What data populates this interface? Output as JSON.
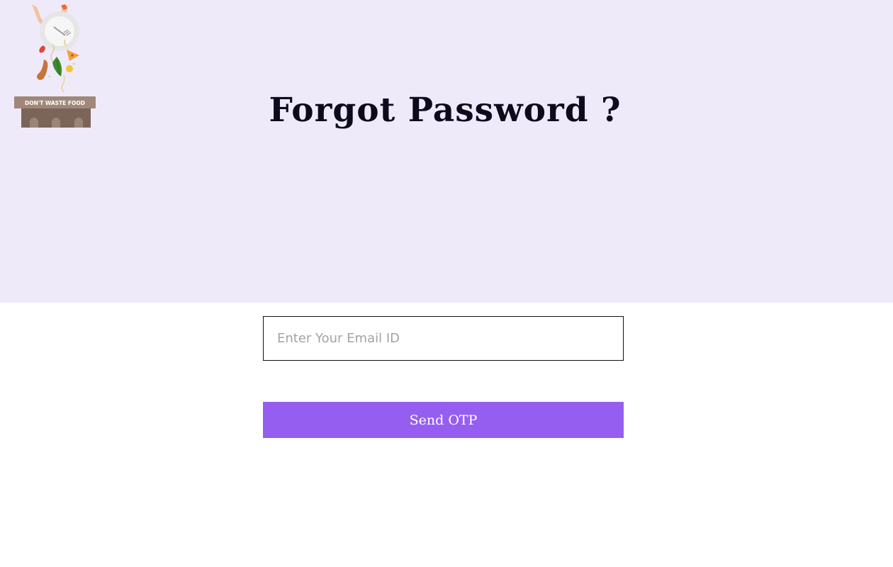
{
  "logo": {
    "icon": "dont-waste-food-logo",
    "sign_text": "DON'T WASTE FOOD"
  },
  "heading": {
    "title": "Forgot Password ?"
  },
  "form": {
    "email_placeholder": "Enter Your Email ID",
    "email_value": "",
    "submit_label": "Send OTP"
  },
  "colors": {
    "hero_background": "#efeafa",
    "accent": "#955ef0",
    "title_text": "#0c0a1c"
  }
}
